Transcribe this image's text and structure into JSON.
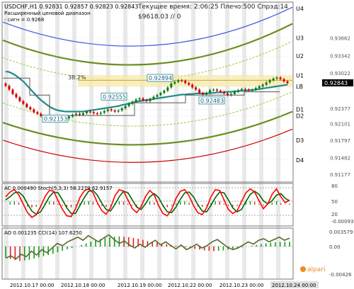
{
  "header": {
    "symbol_line": "USDCHF,H1  0.92831 0.92857 0.92823 0.92843",
    "range_label": "Расширенный ценовой диапазон",
    "range_value": "- сигн = 0.9268",
    "status_line": "Текущее время: 2:06:25 Плечо:500 Спрэд:14",
    "balance_line": "$9618.03      // 0",
    "indicator_ac": "AC 0.000490  Stoch(5,3,3) 58.2279 62.9157",
    "indicator_ao": "AO 0.001235  CCI(14) 107.6250",
    "watermark": "alpari"
  },
  "price_levels": [
    {
      "label": "U4",
      "price": 0.942
    },
    {
      "label": "U3",
      "price": 0.9366
    },
    {
      "label": "U2",
      "price": 0.9333
    },
    {
      "label": "U1",
      "price": 0.9298
    },
    {
      "label": "LB",
      "price": 0.92775
    },
    {
      "label": "D1",
      "price": 0.9236
    },
    {
      "label": "D2",
      "price": 0.9224
    },
    {
      "label": "D3",
      "price": 0.918
    },
    {
      "label": "D4",
      "price": 0.9144
    }
  ],
  "price_ticks": [
    "0.93662",
    "0.93342",
    "0.93022",
    "0.92843",
    "0.92377",
    "0.92101",
    "0.91797",
    "0.91482",
    "0.91177"
  ],
  "current_price": "0.92843",
  "fib_label": "38.2%",
  "point_labels": [
    "0.92894",
    "0.92555",
    "0.92483",
    "0.92153"
  ],
  "ac_ticks": [
    "80",
    "50",
    "20",
    "-0.00093"
  ],
  "ao_ticks": [
    "0.003579",
    "0.00",
    "-0.00426"
  ],
  "time_labels": [
    "2012.10.17 00:00",
    "2012.10.18 00:00",
    "2012.10.19 00:00",
    "2012.10.22 00:00",
    "2012.10.23 00:00",
    "2012.10.24 00:00"
  ],
  "colors": {
    "bull": "#0a7a0a",
    "bear": "#d00000",
    "ma": "#1f8a8a",
    "channel": "#6b8e23",
    "stoch_fast": "#ff0000",
    "stoch_slow": "#006400",
    "cci": "#556b2f"
  },
  "chart_data": [
    {
      "type": "line",
      "title": "USDCHF,H1",
      "xlabel": "",
      "ylabel": "",
      "ylim": [
        0.9105,
        0.943
      ],
      "close": [
        0.9279,
        0.9272,
        0.9264,
        0.9258,
        0.9251,
        0.9246,
        0.924,
        0.9236,
        0.9231,
        0.9228,
        0.9224,
        0.9221,
        0.9218,
        0.9216,
        0.9216,
        0.9219,
        0.9222,
        0.922,
        0.9223,
        0.9226,
        0.9228,
        0.9226,
        0.9229,
        0.9232,
        0.9231,
        0.9229,
        0.9228,
        0.923,
        0.9233,
        0.9236,
        0.9234,
        0.9232,
        0.9234,
        0.9238,
        0.9242,
        0.9246,
        0.925,
        0.9254,
        0.9256,
        0.9253,
        0.9251,
        0.9255,
        0.9259,
        0.9262,
        0.9266,
        0.927,
        0.9276,
        0.9283,
        0.9286,
        0.9289,
        0.9288,
        0.9284,
        0.9281,
        0.9276,
        0.9272,
        0.9266,
        0.9263,
        0.9266,
        0.9271,
        0.9272,
        0.927,
        0.9268,
        0.9265,
        0.9262,
        0.9264,
        0.9268,
        0.9271,
        0.9273,
        0.9272,
        0.927,
        0.9272,
        0.9275,
        0.9278,
        0.9281,
        0.9285,
        0.9289,
        0.9292,
        0.9294,
        0.9291,
        0.9287,
        0.9284
      ],
      "ma": [
        0.9305,
        0.9304,
        0.9301,
        0.9297,
        0.9292,
        0.9287,
        0.928,
        0.9273,
        0.9266,
        0.9259,
        0.9253,
        0.9248,
        0.9243,
        0.9239,
        0.9236,
        0.9234,
        0.9233,
        0.9232,
        0.9232,
        0.9232,
        0.9232,
        0.9232,
        0.9232,
        0.9233,
        0.9234,
        0.9235,
        0.9236,
        0.9237,
        0.9238,
        0.9239,
        0.924,
        0.9241,
        0.9242,
        0.9244,
        0.9245,
        0.9247,
        0.9248,
        0.925,
        0.9251,
        0.9252,
        0.9253,
        0.9254,
        0.9255,
        0.9256,
        0.9257,
        0.9258,
        0.9259,
        0.926,
        0.9261,
        0.9262,
        0.9263,
        0.9263,
        0.9264,
        0.9264,
        0.9265,
        0.9265,
        0.9265,
        0.9265,
        0.9266,
        0.9266,
        0.9267,
        0.9267,
        0.9267,
        0.9268,
        0.9268,
        0.9269,
        0.9269,
        0.927,
        0.927,
        0.9271,
        0.9271,
        0.9272,
        0.9273,
        0.9274,
        0.9275,
        0.9276,
        0.9277,
        0.9278,
        0.9279,
        0.928,
        0.9281
      ]
    },
    {
      "type": "line",
      "title": "Stoch(5,3,3)",
      "ylim": [
        0,
        100
      ],
      "series": [
        {
          "name": "Stoch(5,3,3)",
          "values": [
            70,
            82,
            88,
            75,
            52,
            30,
            18,
            25,
            45,
            70,
            86,
            84,
            60,
            38,
            22,
            20,
            40,
            68,
            85,
            90,
            80,
            55,
            35,
            26,
            42,
            72,
            88,
            84,
            62,
            40,
            30,
            45,
            70,
            86,
            75,
            48,
            28,
            22,
            38,
            66,
            84,
            88,
            72,
            48,
            30,
            25,
            42,
            70,
            88,
            86,
            62,
            38,
            28,
            35,
            58,
            80,
            90,
            82,
            60,
            40,
            52,
            76,
            90,
            70,
            55,
            62
          ]
        },
        {
          "name": "",
          "values": [
            62,
            70,
            80,
            82,
            72,
            52,
            34,
            26,
            32,
            50,
            70,
            82,
            80,
            62,
            42,
            28,
            28,
            48,
            68,
            84,
            86,
            74,
            54,
            38,
            34,
            50,
            70,
            84,
            80,
            62,
            44,
            38,
            52,
            70,
            78,
            68,
            48,
            32,
            30,
            44,
            64,
            80,
            82,
            70,
            50,
            34,
            32,
            48,
            68,
            82,
            80,
            62,
            42,
            32,
            38,
            58,
            76,
            84,
            76,
            60,
            52,
            60,
            74,
            78,
            66,
            60
          ]
        }
      ]
    },
    {
      "type": "bar",
      "title": "AO / CCI(14)",
      "series": [
        {
          "name": "AO",
          "values": [
            -0.0028,
            -0.0032,
            -0.0035,
            -0.0037,
            -0.0036,
            -0.0034,
            -0.0031,
            -0.0028,
            -0.0025,
            -0.0022,
            -0.0019,
            -0.0015,
            -0.0011,
            -0.0007,
            -0.0004,
            0.0,
            0.0004,
            0.0008,
            0.0012,
            0.0016,
            0.0019,
            0.0022,
            0.0024,
            0.0025,
            0.0026,
            0.0025,
            0.0024,
            0.0022,
            0.002,
            0.0017,
            0.0014,
            0.0012,
            0.001,
            0.0008,
            0.0006,
            0.0004,
            0.0002,
            0.0,
            -0.0002,
            -0.0004,
            -0.0006,
            -0.0008,
            -0.001,
            -0.0011,
            -0.0012,
            -0.0011,
            -0.001,
            -0.0008,
            -0.0006,
            -0.0004,
            -0.0002,
            0.0,
            0.0002,
            0.0004,
            0.0006,
            0.0008,
            0.001,
            0.0011,
            0.0012,
            0.0012,
            0.0012
          ]
        },
        {
          "name": "CCI(14)",
          "values": [
            -150,
            -120,
            -160,
            -100,
            -130,
            -60,
            -110,
            -40,
            -80,
            -20,
            40,
            10,
            60,
            90,
            120,
            80,
            140,
            100,
            60,
            110,
            150,
            90,
            40,
            70,
            20,
            -20,
            30,
            -10,
            40,
            80,
            20,
            60,
            10,
            -30,
            20,
            -40,
            -10,
            30,
            -20,
            10,
            60,
            90,
            40,
            -10,
            -40,
            -20,
            20,
            60,
            30,
            80,
            100,
            60,
            90,
            120,
            80,
            107
          ]
        }
      ]
    }
  ]
}
